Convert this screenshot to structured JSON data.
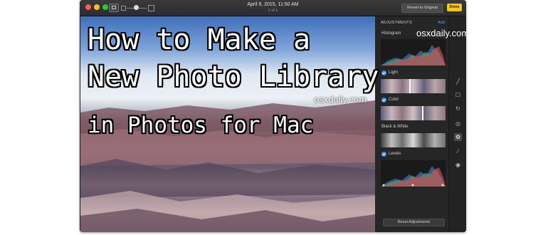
{
  "window": {
    "date": "April 9, 2015, 11:50 AM",
    "count": "1 of 1",
    "revert_label": "Revert to Original",
    "done_label": "Done"
  },
  "overlay": {
    "line1": "How to Make a",
    "line2": "New Photo Library",
    "line3": "in Photos for Mac"
  },
  "watermarks": [
    "osxdaily.com",
    "osxdaily.com"
  ],
  "panel": {
    "title": "ADJUSTMENTS",
    "add_label": "Add",
    "histogram_label": "Histogram",
    "light_label": "Light",
    "color_label": "Color",
    "bw_label": "Black & White",
    "levels_label": "Levels",
    "reset_label": "Reset Adjustments"
  },
  "tools": [
    "magic-wand-icon",
    "crop-icon",
    "rotate-icon",
    "filters-icon",
    "adjust-icon",
    "bandage-icon",
    "eye-icon"
  ],
  "colors": {
    "done": "#f4c51d",
    "accent": "#4aa3ff",
    "check": "#3b8ff5"
  }
}
